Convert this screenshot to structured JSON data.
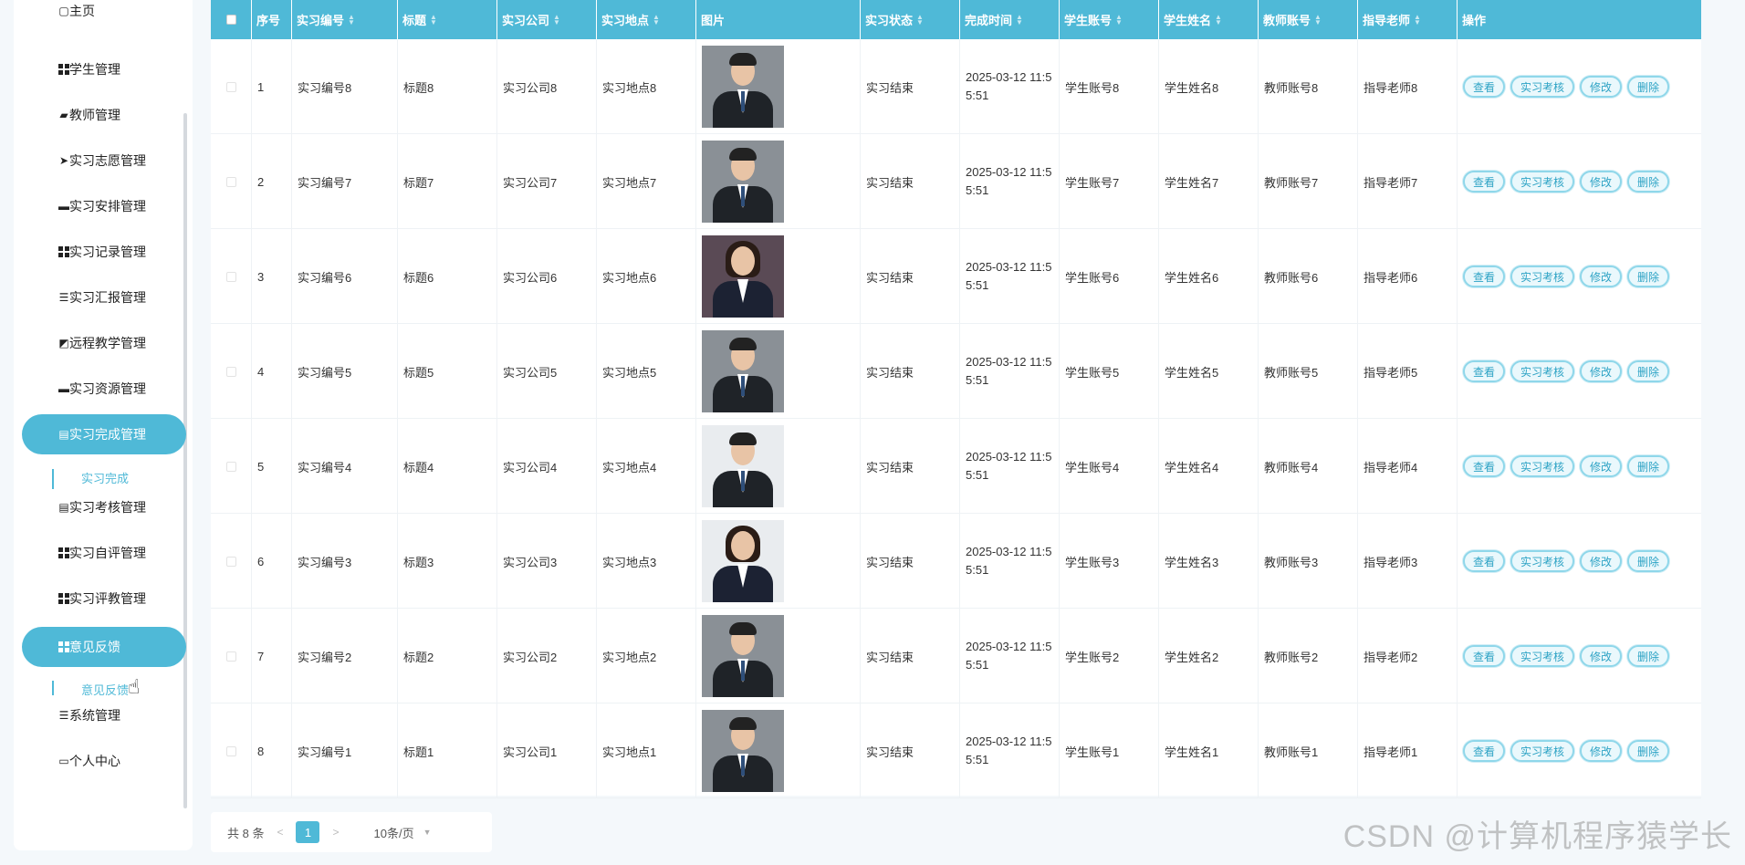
{
  "sidebar": {
    "items": [
      {
        "label": "主页",
        "icon": "home-icon",
        "glyph": "▢"
      },
      {
        "label": "学生管理",
        "icon": "grid-icon",
        "glyph": "grid"
      },
      {
        "label": "教师管理",
        "icon": "briefcase-icon",
        "glyph": "▰"
      },
      {
        "label": "实习志愿管理",
        "icon": "send-icon",
        "glyph": "➤"
      },
      {
        "label": "实习安排管理",
        "icon": "monitor-icon",
        "glyph": "▬"
      },
      {
        "label": "实习记录管理",
        "icon": "grid-icon",
        "glyph": "grid"
      },
      {
        "label": "实习汇报管理",
        "icon": "list-icon",
        "glyph": "☰"
      },
      {
        "label": "远程教学管理",
        "icon": "chart-icon",
        "glyph": "◩"
      },
      {
        "label": "实习资源管理",
        "icon": "monitor-icon",
        "glyph": "▬"
      },
      {
        "label": "实习完成管理",
        "icon": "clipboard-icon",
        "glyph": "▤",
        "active": true
      },
      {
        "label": "实习考核管理",
        "icon": "clipboard-icon",
        "glyph": "▤"
      },
      {
        "label": "实习自评管理",
        "icon": "grid-icon",
        "glyph": "grid"
      },
      {
        "label": "实习评教管理",
        "icon": "grid-icon",
        "glyph": "grid"
      },
      {
        "label": "意见反馈",
        "icon": "grid-icon",
        "glyph": "grid",
        "active": true
      },
      {
        "label": "系统管理",
        "icon": "list-icon",
        "glyph": "☰"
      },
      {
        "label": "个人中心",
        "icon": "card-icon",
        "glyph": "▭"
      }
    ],
    "sub_completion": "实习完成",
    "sub_feedback": "意见反馈"
  },
  "table": {
    "columns": [
      "",
      "序号",
      "实习编号",
      "标题",
      "实习公司",
      "实习地点",
      "图片",
      "实习状态",
      "完成时间",
      "学生账号",
      "学生姓名",
      "教师账号",
      "指导老师",
      "操作"
    ],
    "sortable": [
      false,
      false,
      true,
      true,
      true,
      true,
      false,
      true,
      true,
      true,
      true,
      true,
      true,
      false
    ],
    "rows": [
      {
        "idx": "1",
        "code": "实习编号8",
        "title": "标题8",
        "company": "实习公司8",
        "place": "实习地点8",
        "photo": "male",
        "status": "实习结束",
        "time": "2025-03-12 11:55:51",
        "stu_acc": "学生账号8",
        "stu_name": "学生姓名8",
        "tea_acc": "教师账号8",
        "mentor": "指导老师8"
      },
      {
        "idx": "2",
        "code": "实习编号7",
        "title": "标题7",
        "company": "实习公司7",
        "place": "实习地点7",
        "photo": "male",
        "status": "实习结束",
        "time": "2025-03-12 11:55:51",
        "stu_acc": "学生账号7",
        "stu_name": "学生姓名7",
        "tea_acc": "教师账号7",
        "mentor": "指导老师7"
      },
      {
        "idx": "3",
        "code": "实习编号6",
        "title": "标题6",
        "company": "实习公司6",
        "place": "实习地点6",
        "photo": "female",
        "status": "实习结束",
        "time": "2025-03-12 11:55:51",
        "stu_acc": "学生账号6",
        "stu_name": "学生姓名6",
        "tea_acc": "教师账号6",
        "mentor": "指导老师6"
      },
      {
        "idx": "4",
        "code": "实习编号5",
        "title": "标题5",
        "company": "实习公司5",
        "place": "实习地点5",
        "photo": "male",
        "status": "实习结束",
        "time": "2025-03-12 11:55:51",
        "stu_acc": "学生账号5",
        "stu_name": "学生姓名5",
        "tea_acc": "教师账号5",
        "mentor": "指导老师5"
      },
      {
        "idx": "5",
        "code": "实习编号4",
        "title": "标题4",
        "company": "实习公司4",
        "place": "实习地点4",
        "photo": "male-light",
        "status": "实习结束",
        "time": "2025-03-12 11:55:51",
        "stu_acc": "学生账号4",
        "stu_name": "学生姓名4",
        "tea_acc": "教师账号4",
        "mentor": "指导老师4"
      },
      {
        "idx": "6",
        "code": "实习编号3",
        "title": "标题3",
        "company": "实习公司3",
        "place": "实习地点3",
        "photo": "female-light",
        "status": "实习结束",
        "time": "2025-03-12 11:55:51",
        "stu_acc": "学生账号3",
        "stu_name": "学生姓名3",
        "tea_acc": "教师账号3",
        "mentor": "指导老师3"
      },
      {
        "idx": "7",
        "code": "实习编号2",
        "title": "标题2",
        "company": "实习公司2",
        "place": "实习地点2",
        "photo": "male",
        "status": "实习结束",
        "time": "2025-03-12 11:55:51",
        "stu_acc": "学生账号2",
        "stu_name": "学生姓名2",
        "tea_acc": "教师账号2",
        "mentor": "指导老师2"
      },
      {
        "idx": "8",
        "code": "实习编号1",
        "title": "标题1",
        "company": "实习公司1",
        "place": "实习地点1",
        "photo": "male",
        "status": "实习结束",
        "time": "2025-03-12 11:55:51",
        "stu_acc": "学生账号1",
        "stu_name": "学生姓名1",
        "tea_acc": "教师账号1",
        "mentor": "指导老师1"
      }
    ],
    "actions": [
      "查看",
      "实习考核",
      "修改",
      "删除"
    ]
  },
  "pagination": {
    "total": "共 8 条",
    "prev": "<",
    "current": "1",
    "next": ">",
    "page_size": "10条/页"
  },
  "watermark": "CSDN @计算机程序猿学长",
  "colors": {
    "accent": "#4fb9d7",
    "button_text": "#2ea3c5"
  }
}
